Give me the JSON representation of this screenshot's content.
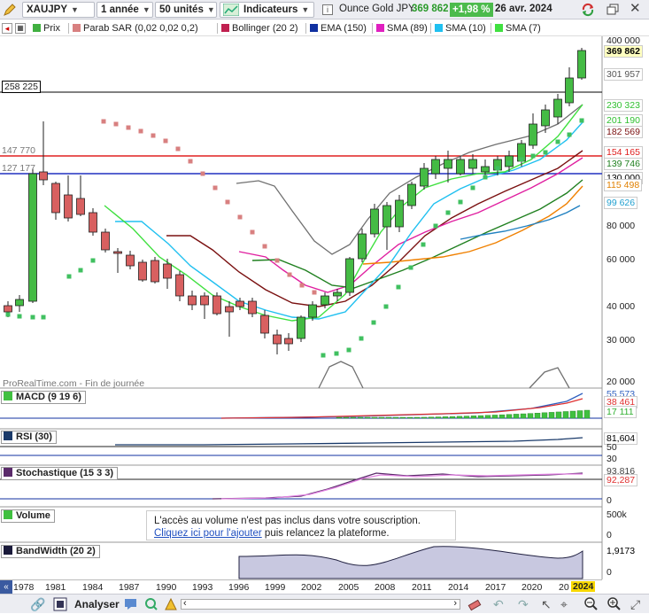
{
  "toolbar": {
    "symbol": "XAUJPY",
    "period": "1 année",
    "units": "50 unités",
    "indicators": "Indicateurs",
    "instrument": "Ounce Gold JPY",
    "price": "369 862",
    "change": "+1,98 %",
    "date": "26 avr. 2024"
  },
  "legend": [
    {
      "label": "Prix",
      "color": "#40b040"
    },
    {
      "label": "Parab SAR (0,02 0,02 0,2)",
      "color": "#d88080"
    },
    {
      "label": "Bollinger (20 2)",
      "color": "#c02050"
    },
    {
      "label": "EMA (150)",
      "color": "#1030a0"
    },
    {
      "label": "SMA (89)",
      "color": "#e020c0"
    },
    {
      "label": "SMA (10)",
      "color": "#20c0f0"
    },
    {
      "label": "SMA (7)",
      "color": "#40e040"
    }
  ],
  "price_axis": [
    "400 000",
    "80 000",
    "60 000",
    "40 000",
    "30 000",
    "20 000"
  ],
  "price_tags": [
    {
      "text": "369 862",
      "bg": "#ffffc0",
      "color": "#000"
    },
    {
      "text": "301 957",
      "bg": "#fff",
      "color": "#555"
    },
    {
      "text": "230 323",
      "bg": "#fff",
      "color": "#30c030"
    },
    {
      "text": "201 190",
      "bg": "#fff",
      "color": "#30c030"
    },
    {
      "text": "182 569",
      "bg": "#fff",
      "color": "#7a1010"
    },
    {
      "text": "154 165",
      "bg": "#fff",
      "color": "#e02020"
    },
    {
      "text": "139 746",
      "bg": "#fff",
      "color": "#208020"
    },
    {
      "text": "130 000",
      "bg": "#fff",
      "color": "#000"
    },
    {
      "text": "115 498",
      "bg": "#fff",
      "color": "#e08000"
    },
    {
      "text": "99 626",
      "bg": "#fff",
      "color": "#20a0d0"
    }
  ],
  "hlines": {
    "black": "258 225",
    "red": "147 770",
    "blue": "127 177"
  },
  "watermark": "ProRealTime.com - Fin de journée",
  "panels": {
    "macd": {
      "title": "MACD (9 19 6)",
      "values": [
        "55 573",
        "38 461",
        "17 111"
      ]
    },
    "rsi": {
      "title": "RSI (30)",
      "values": [
        "81,604",
        "50",
        "30"
      ]
    },
    "stoch": {
      "title": "Stochastique (15 3 3)",
      "values": [
        "93,816",
        "92,287",
        "0"
      ]
    },
    "volume": {
      "title": "Volume",
      "values": [
        "500k",
        "0"
      ]
    },
    "bandwidth": {
      "title": "BandWidth (20 2)",
      "values": [
        "1,9173",
        "0"
      ]
    }
  },
  "notice": {
    "line1": "L'accès au volume n'est pas inclus dans votre souscription.",
    "link": "Cliquez ici pour l'ajouter",
    "line2": " puis relancez la plateforme."
  },
  "xaxis": [
    "1978",
    "1981",
    "1984",
    "1987",
    "1990",
    "1993",
    "1996",
    "1999",
    "2002",
    "2005",
    "2008",
    "2011",
    "2014",
    "2017",
    "2020",
    "20",
    "2024"
  ],
  "bottom": {
    "analyser": "Analyser"
  },
  "colors": {
    "up": "#44bb44",
    "down": "#d86060",
    "sar": "#d88080",
    "sar_up": "#40c060"
  }
}
